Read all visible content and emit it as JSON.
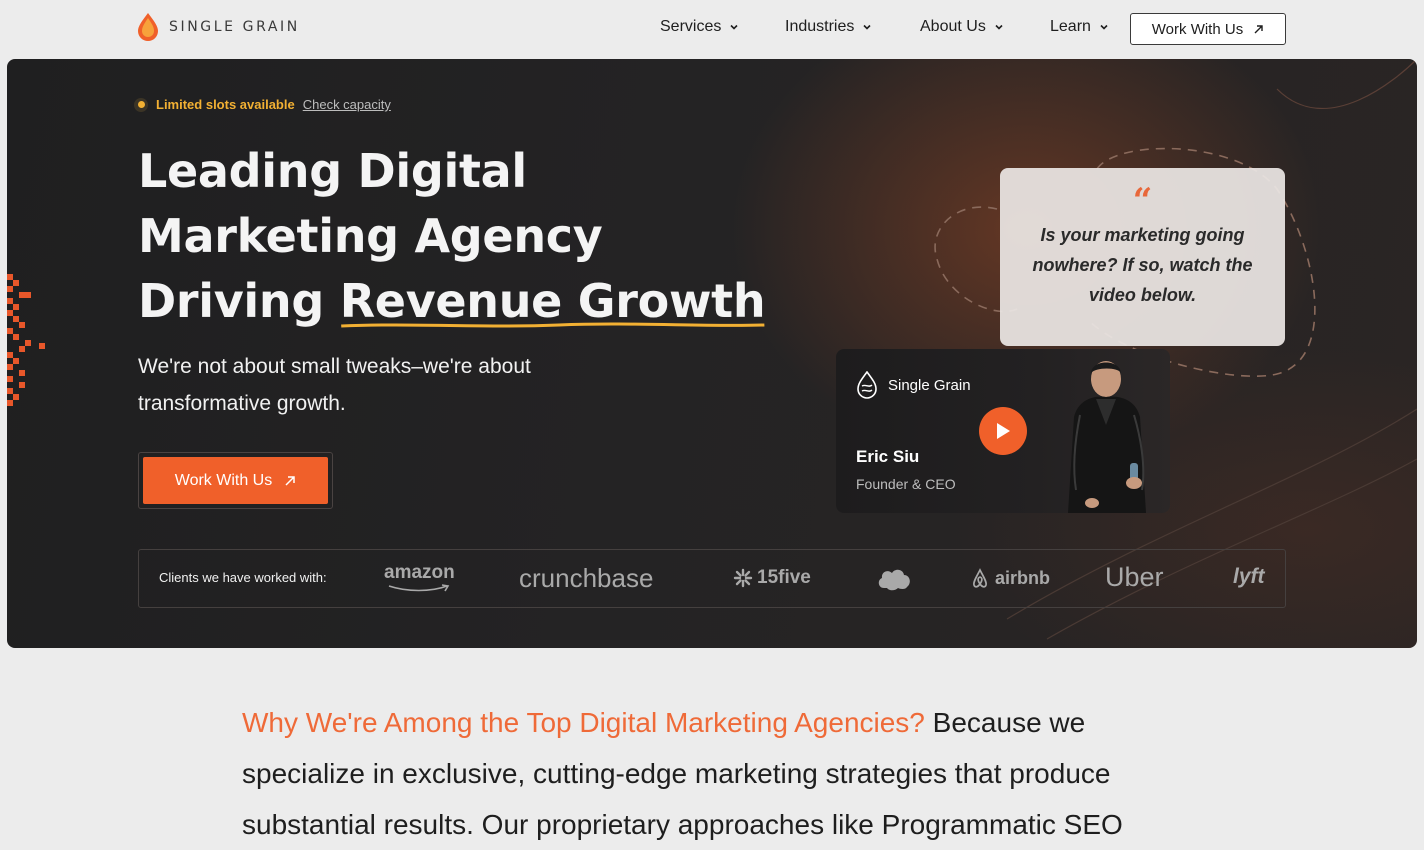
{
  "nav": {
    "logo_text": "SINGLE GRAIN",
    "items": [
      {
        "label": "Services"
      },
      {
        "label": "Industries"
      },
      {
        "label": "About Us"
      },
      {
        "label": "Learn"
      }
    ],
    "cta_label": "Work With Us"
  },
  "hero": {
    "pill": {
      "strong": "Limited slots available",
      "link": "Check capacity"
    },
    "headline": {
      "line1": "Leading Digital",
      "line2": "Marketing Agency",
      "line3_plain": "Driving ",
      "line3_underlined": "Revenue Growth"
    },
    "subtitle": "We're not about small tweaks–we're about transformative growth.",
    "cta_label": "Work With Us",
    "quote": {
      "mark": "“",
      "text": "Is your marketing going nowhere? If so, watch the video below."
    },
    "video": {
      "brand": "Single Grain",
      "name": "Eric Siu",
      "role": "Founder & CEO"
    },
    "clients": {
      "label": "Clients we have worked with:",
      "logos": [
        "amazon",
        "crunchbase",
        "15five",
        "salesforce",
        "airbnb",
        "Uber",
        "lyft"
      ]
    }
  },
  "body": {
    "accent": "Why We're Among the Top Digital Marketing Agencies?",
    "text": " Because we specialize in exclusive, cutting-edge marketing strategies that produce substantial results. Our proprietary approaches like Programmatic SEO"
  },
  "colors": {
    "accent": "#f0602a",
    "pill": "#f2b033",
    "hero_bg": "#232223",
    "page_bg": "#ececec"
  },
  "icons": [
    "logo-drop-icon",
    "chevron-down-icon",
    "arrow-up-right-icon",
    "play-icon",
    "single-grain-logo-icon"
  ]
}
